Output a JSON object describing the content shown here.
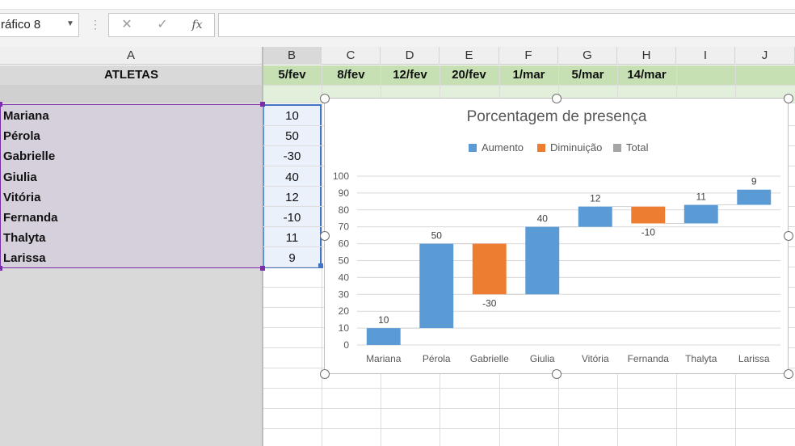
{
  "formula_bar": {
    "name_box": "ráfico 8",
    "cancel_glyph": "✕",
    "enter_glyph": "✓",
    "fx_glyph": "fx"
  },
  "columns": [
    "A",
    "B",
    "C",
    "D",
    "E",
    "F",
    "G",
    "H",
    "I",
    "J"
  ],
  "header_row": {
    "atletas": "ATLETAS",
    "dates": [
      "5/fev",
      "8/fev",
      "12/fev",
      "20/fev",
      "1/mar",
      "5/mar",
      "14/mar"
    ]
  },
  "athletes": [
    {
      "name": "Mariana",
      "value": "10"
    },
    {
      "name": "Pérola",
      "value": "50"
    },
    {
      "name": "Gabrielle",
      "value": "-30"
    },
    {
      "name": "Giulia",
      "value": "40"
    },
    {
      "name": "Vitória",
      "value": "12"
    },
    {
      "name": "Fernanda",
      "value": "-10"
    },
    {
      "name": "Thalyta",
      "value": "11"
    },
    {
      "name": "Larissa",
      "value": "9"
    }
  ],
  "colors": {
    "increase": "#5b9bd5",
    "decrease": "#ed7d31",
    "total": "#a5a5a5",
    "header_green": "#c6e0b4",
    "selection_fill": "#d5d0dc",
    "selected_col_b": "#eaf1fb",
    "selection_border": "#4472c4",
    "range_purple": "#7a2fa6"
  },
  "chart_data": {
    "type": "waterfall",
    "title": "Porcentagem de presença",
    "legend": [
      "Aumento",
      "Diminuição",
      "Total"
    ],
    "legend_position": "top",
    "categories": [
      "Mariana",
      "Pérola",
      "Gabrielle",
      "Giulia",
      "Vitória",
      "Fernanda",
      "Thalyta",
      "Larissa"
    ],
    "values": [
      10,
      50,
      -30,
      40,
      12,
      -10,
      11,
      9
    ],
    "data_labels": [
      "10",
      "50",
      "-30",
      "40",
      "12",
      "-10",
      "11",
      "9"
    ],
    "ylim": [
      0,
      100
    ],
    "yticks": [
      "100",
      "90",
      "80",
      "70",
      "60",
      "50",
      "40",
      "30",
      "20",
      "10",
      "0"
    ],
    "grid": true
  }
}
